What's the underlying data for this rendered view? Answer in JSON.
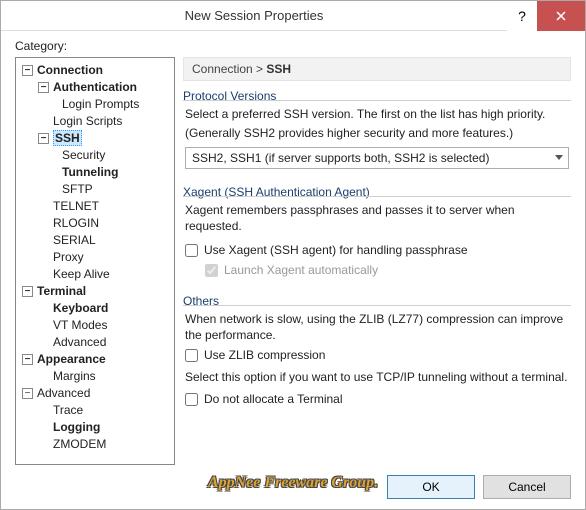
{
  "window": {
    "title": "New Session Properties"
  },
  "categoryLabel": "Category:",
  "breadcrumb": {
    "parent": "Connection",
    "sep": " > ",
    "current": "SSH"
  },
  "tree": {
    "connection": "Connection",
    "authentication": "Authentication",
    "loginPrompts": "Login Prompts",
    "loginScripts": "Login Scripts",
    "ssh": "SSH",
    "security": "Security",
    "tunneling": "Tunneling",
    "sftp": "SFTP",
    "telnet": "TELNET",
    "rlogin": "RLOGIN",
    "serial": "SERIAL",
    "proxy": "Proxy",
    "keepAlive": "Keep Alive",
    "terminal": "Terminal",
    "keyboard": "Keyboard",
    "vtModes": "VT Modes",
    "advancedT": "Advanced",
    "appearance": "Appearance",
    "margins": "Margins",
    "advanced": "Advanced",
    "trace": "Trace",
    "logging": "Logging",
    "zmodem": "ZMODEM"
  },
  "protocolVersions": {
    "title": "Protocol Versions",
    "line1": "Select a preferred SSH version. The first on the list has high priority.",
    "line2": "(Generally SSH2 provides higher security and more features.)",
    "comboValue": "SSH2, SSH1 (if server supports both, SSH2 is selected)"
  },
  "xagent": {
    "title": "Xagent (SSH Authentication Agent)",
    "desc": "Xagent remembers passphrases and passes it to server when requested.",
    "useXagent": "Use Xagent (SSH agent) for handling passphrase",
    "launchAuto": "Launch Xagent automatically"
  },
  "others": {
    "title": "Others",
    "desc1": "When network is slow, using the ZLIB (LZ77) compression can improve the performance.",
    "useZlib": "Use ZLIB compression",
    "desc2": "Select this option if you want to use TCP/IP tunneling without a terminal.",
    "noTerminal": "Do not allocate a Terminal"
  },
  "buttons": {
    "ok": "OK",
    "cancel": "Cancel"
  },
  "watermark": "AppNee Freeware Group."
}
